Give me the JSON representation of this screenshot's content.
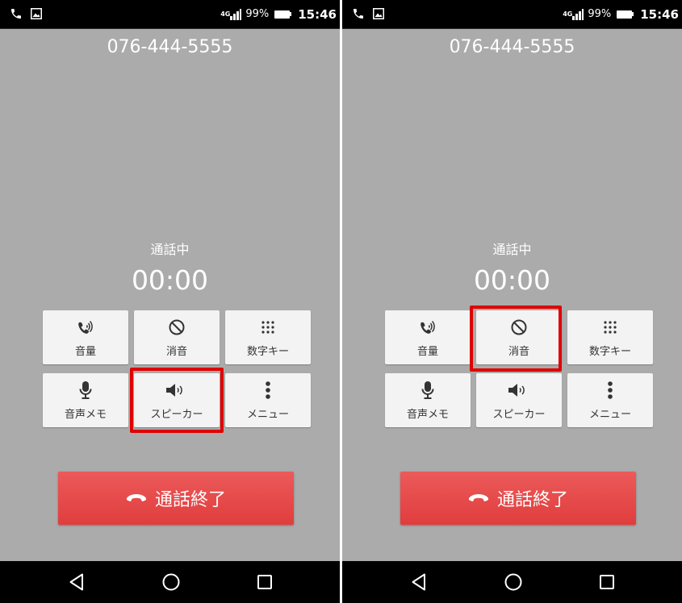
{
  "colors": {
    "screen_background": "#ababab",
    "button_background": "#f3f3f3",
    "end_call_red": "#e84848",
    "highlight_red": "#e00000",
    "bar_black": "#000000"
  },
  "status_bar": {
    "network": "4G",
    "battery_percent": "99%",
    "time": "15:46",
    "icons": [
      "phone-call-icon",
      "image-icon",
      "signal-icon",
      "battery-icon"
    ]
  },
  "screens": [
    {
      "phone_number": "076-444-5555",
      "call_state": "通話中",
      "timer": "00:00",
      "buttons": {
        "volume": "音量",
        "mute": "消音",
        "keypad": "数字キー",
        "voice_memo": "音声メモ",
        "speaker": "スピーカー",
        "menu": "メニュー"
      },
      "highlighted_button": "speaker",
      "end_call_label": "通話終了"
    },
    {
      "phone_number": "076-444-5555",
      "call_state": "通話中",
      "timer": "00:00",
      "buttons": {
        "volume": "音量",
        "mute": "消音",
        "keypad": "数字キー",
        "voice_memo": "音声メモ",
        "speaker": "スピーカー",
        "menu": "メニュー"
      },
      "highlighted_button": "mute",
      "end_call_label": "通話終了"
    }
  ]
}
